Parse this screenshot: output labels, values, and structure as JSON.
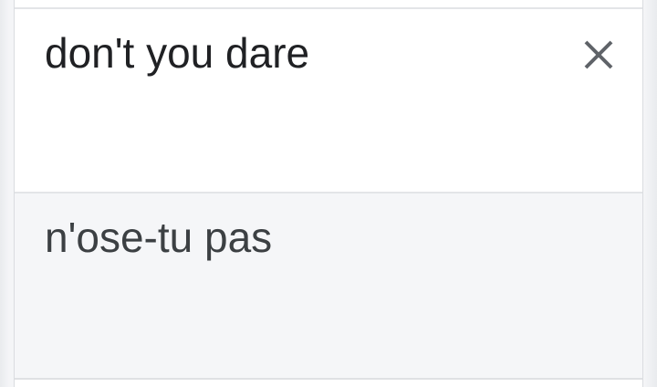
{
  "translator": {
    "source": {
      "text": "don't you dare",
      "clear_icon": "close-icon"
    },
    "result": {
      "text": "n'ose-tu pas"
    }
  }
}
